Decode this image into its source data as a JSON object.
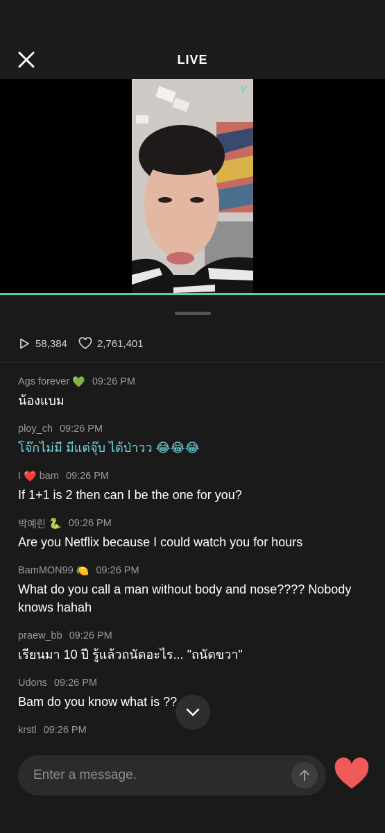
{
  "header": {
    "title": "LIVE"
  },
  "video": {
    "badge": "V"
  },
  "stats": {
    "plays": "58,384",
    "likes": "2,761,401"
  },
  "messages": [
    {
      "user": "Ags forever",
      "badge": "💚",
      "time": "09:26 PM",
      "text": "น้องแบม",
      "teal": false
    },
    {
      "user": "ploy_ch",
      "badge": "",
      "time": "09:26 PM",
      "text": "โจ๊กไม่มี มีแต่จุ๊บ ได้ป่าวว",
      "emoji": "😂😂😂",
      "teal": true
    },
    {
      "user_prefix": "I",
      "user_heart": "❤️",
      "user": "bam",
      "time": "09:26 PM",
      "text": "If 1+1 is 2 then can I be the one for you?",
      "teal": false
    },
    {
      "user": "박예린",
      "badge": "🐍",
      "time": "09:26 PM",
      "text": "Are you Netflix because I could watch you for hours",
      "teal": false
    },
    {
      "user": "BamMON99",
      "badge": "🍋",
      "time": "09:26 PM",
      "text": "What do you call a man without body and nose???? Nobody knows hahah",
      "teal": false
    },
    {
      "user": "praew_bb",
      "badge": "",
      "time": "09:26 PM",
      "text": "เรียนมา 10 ปี รู้แล้วถนัดอะไร... \"ถนัดขวา\"",
      "teal": false
    },
    {
      "user": "Udons",
      "badge": "",
      "time": "09:26 PM",
      "text": "Bam do you know what is ??",
      "teal": false
    },
    {
      "user": "krstl",
      "badge": "",
      "time": "09:26 PM",
      "text": "",
      "teal": false
    }
  ],
  "composer": {
    "placeholder": "Enter a message."
  },
  "colors": {
    "accent": "#4fd1b5",
    "heart": "#f05a5a",
    "teal_text": "#6fd8de"
  }
}
